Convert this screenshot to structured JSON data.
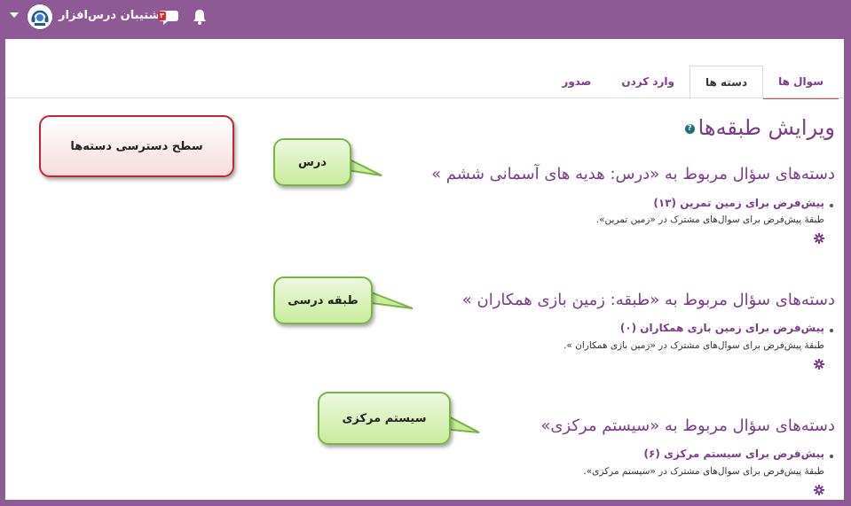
{
  "topbar": {
    "user_name": "پشتیبان درس‌افزار",
    "notification_count": "۳",
    "colors": {
      "bar": "#8e5a95",
      "badge": "#e0262b"
    },
    "icons": [
      "caret-down-icon",
      "avatar-icon",
      "chat-icon",
      "bell-icon"
    ]
  },
  "tabs": [
    {
      "label": "سوال ها"
    },
    {
      "label": "دسته ها"
    },
    {
      "label": "وارد کردن"
    },
    {
      "label": "صدور"
    }
  ],
  "page": {
    "title": "ویرایش طبقه‌ها"
  },
  "sections": [
    {
      "heading": "دسته‌های سؤال مربوط به «درس: هدیه های آسمانی ششم »",
      "item_title": "پیش‌فرض برای زمین تمرین (۱۳)",
      "item_desc": "طبقهٔ پیش‌فرض برای سوال‌های مشترک در «زمین تمرین».",
      "callout": "درس"
    },
    {
      "heading": "دسته‌های سؤال مربوط به «طبقه: زمین بازی همکاران »",
      "item_title": "پیش‌فرض برای زمین بازی همکاران (۰)",
      "item_desc": "طبقهٔ پیش‌فرض برای سوال‌های مشترک در «زمین بازی همکاران ».",
      "callout": "طبقه درسی"
    },
    {
      "heading": "دسته‌های سؤال مربوط به «سیستم مرکزی»",
      "item_title": "پیش‌فرض برای سیستم مرکزی (۶)",
      "item_desc": "طبقهٔ پیش‌فرض برای سوال‌های مشترک در «سیستم مرکزی».",
      "callout": "سیستم مرکزی"
    }
  ],
  "access_callout": "سطح دسترسی دسته‌ها"
}
